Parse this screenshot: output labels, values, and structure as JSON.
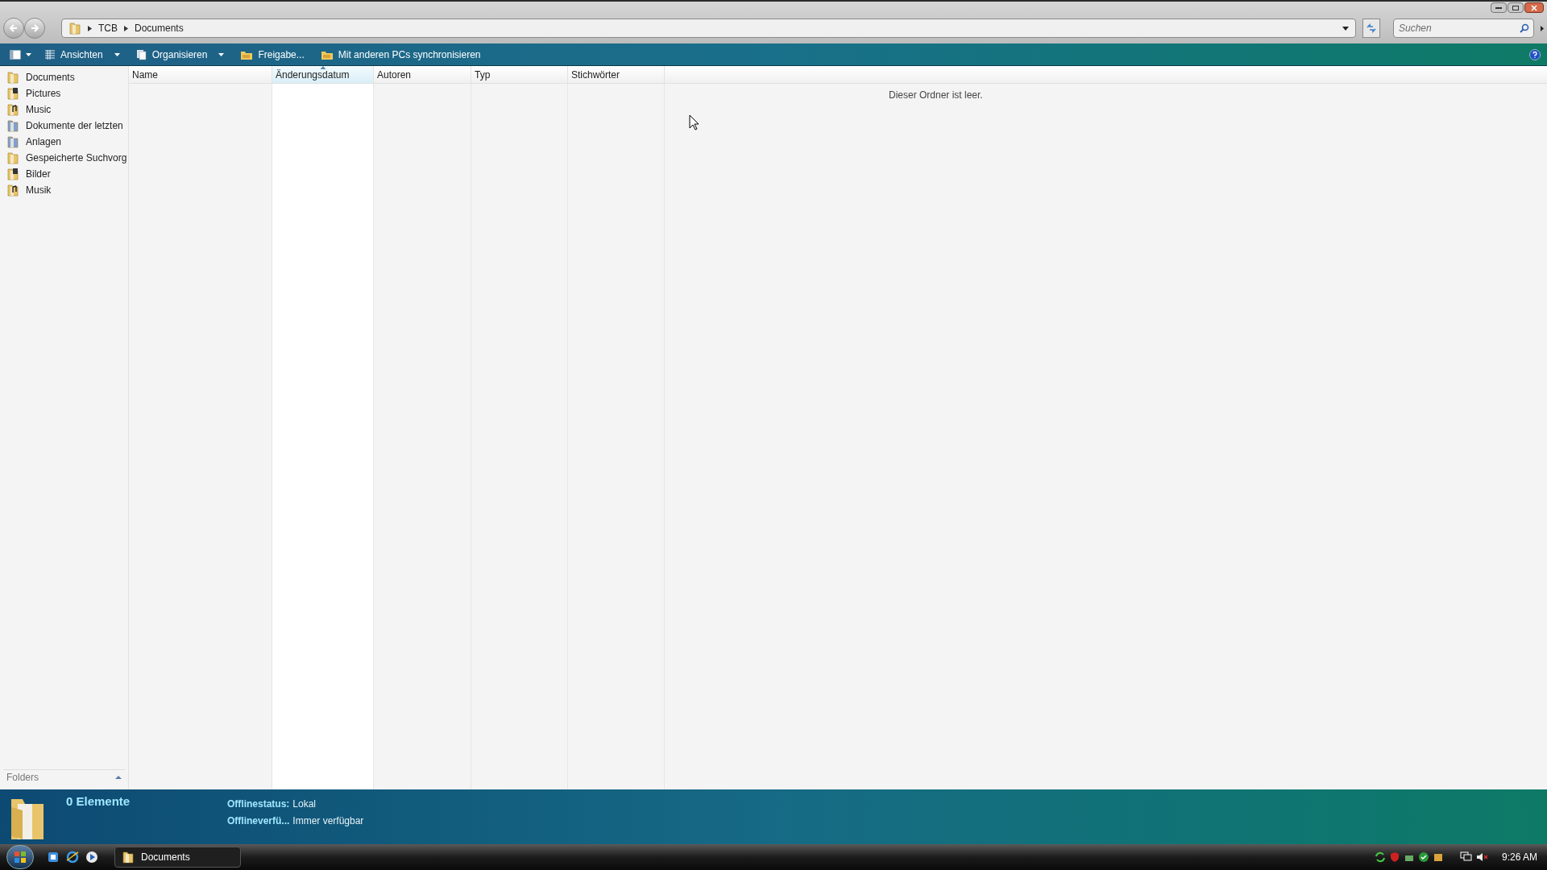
{
  "address_bar": {
    "breadcrumbs": [
      "TCB",
      "Documents"
    ]
  },
  "search": {
    "placeholder": "Suchen"
  },
  "toolbar": {
    "buttons": [
      {
        "label": "Ansichten",
        "dropdown": true,
        "kind": "views"
      },
      {
        "label": "Organisieren",
        "dropdown": true,
        "kind": "organize"
      },
      {
        "label": "Freigabe...",
        "dropdown": false,
        "kind": "share"
      },
      {
        "label": "Mit anderen PCs synchronisieren",
        "dropdown": false,
        "kind": "share"
      }
    ]
  },
  "sidebar": {
    "items": [
      {
        "label": "Documents",
        "kind": "folder"
      },
      {
        "label": "Pictures",
        "kind": "pictures"
      },
      {
        "label": "Music",
        "kind": "music"
      },
      {
        "label": "Dokumente der letzten",
        "kind": "special"
      },
      {
        "label": "Anlagen",
        "kind": "special"
      },
      {
        "label": "Gespeicherte Suchvorg",
        "kind": "folder"
      },
      {
        "label": "Bilder",
        "kind": "pictures"
      },
      {
        "label": "Musik",
        "kind": "music"
      }
    ],
    "folders_label": "Folders"
  },
  "table": {
    "columns": [
      {
        "label": "Name",
        "selected": false
      },
      {
        "label": "Änderungsdatum",
        "selected": true
      },
      {
        "label": "Autoren",
        "selected": false
      },
      {
        "label": "Typ",
        "selected": false
      },
      {
        "label": "Stichwörter",
        "selected": false
      }
    ],
    "empty_message": "Dieser Ordner ist leer."
  },
  "details_pane": {
    "count": "0 Elemente",
    "properties": [
      {
        "name": "Offlinestatus:",
        "value": "Lokal"
      },
      {
        "name": "Offlineverfü...",
        "value": "Immer verfügbar"
      }
    ]
  },
  "taskbar": {
    "windows": [
      {
        "label": "Documents",
        "selected": true
      }
    ],
    "clock": "9:26 AM"
  }
}
